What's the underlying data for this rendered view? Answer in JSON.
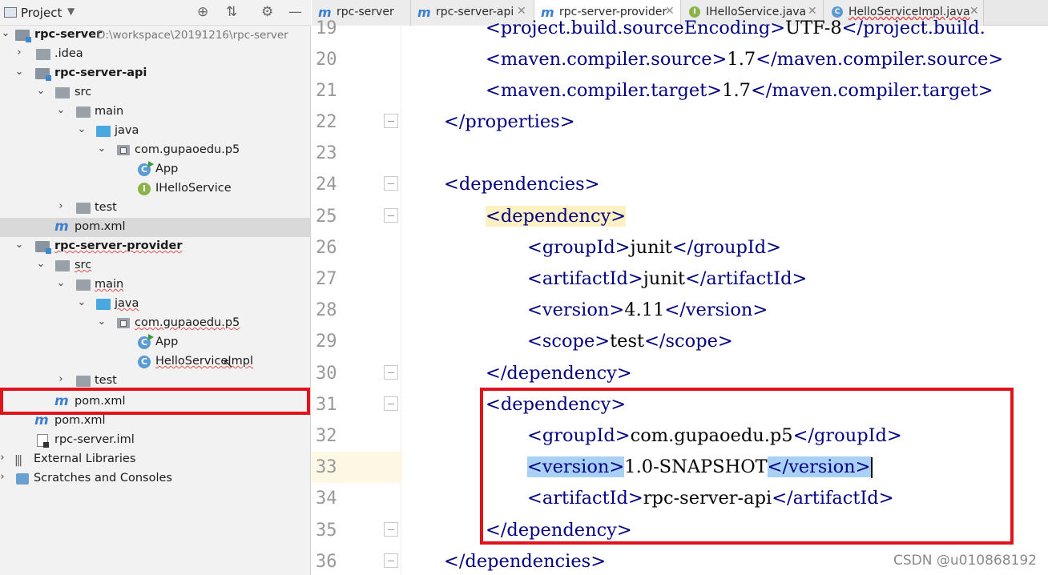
{
  "project_panel": {
    "title": "Project",
    "tree": [
      {
        "label": "rpc-server",
        "path": "D:\\workspace\\20191216\\rpc-server"
      },
      {
        "label": ".idea"
      },
      {
        "label": "rpc-server-api"
      },
      {
        "label": "src"
      },
      {
        "label": "main"
      },
      {
        "label": "java"
      },
      {
        "label": "com.gupaoedu.p5"
      },
      {
        "label": "App"
      },
      {
        "label": "IHelloService"
      },
      {
        "label": "test"
      },
      {
        "label": "pom.xml"
      },
      {
        "label": "rpc-server-provider"
      },
      {
        "label": "src"
      },
      {
        "label": "main"
      },
      {
        "label": "java"
      },
      {
        "label": "com.gupaoedu.p5"
      },
      {
        "label": "App"
      },
      {
        "label": "HelloServiceImpl"
      },
      {
        "label": "test"
      },
      {
        "label": "pom.xml"
      },
      {
        "label": "pom.xml"
      },
      {
        "label": "rpc-server.iml"
      },
      {
        "label": "External Libraries"
      },
      {
        "label": "Scratches and Consoles"
      }
    ]
  },
  "tabs": [
    {
      "label": "rpc-server",
      "icon": "maven-icon"
    },
    {
      "label": "rpc-server-api",
      "icon": "maven-icon"
    },
    {
      "label": "rpc-server-provider",
      "icon": "maven-icon",
      "active": true
    },
    {
      "label": "IHelloService.java",
      "icon": "interface-icon"
    },
    {
      "label": "HelloServiceImpl.java",
      "icon": "class-icon"
    }
  ],
  "editor": {
    "line_numbers": [
      "19",
      "20",
      "21",
      "22",
      "23",
      "24",
      "25",
      "26",
      "27",
      "28",
      "29",
      "30",
      "31",
      "32",
      "33",
      "34",
      "35",
      "36"
    ],
    "lines": [
      {
        "open": "<project.build.sourceEncoding>",
        "text": "UTF-8",
        "close": "</project.build."
      },
      {
        "open": "<maven.compiler.source>",
        "text": "1.7",
        "close": "</maven.compiler.source>"
      },
      {
        "open": "<maven.compiler.target>",
        "text": "1.7",
        "close": "</maven.compiler.target>"
      },
      {
        "open": "</properties>",
        "text": "",
        "close": ""
      },
      {
        "open": "",
        "text": "",
        "close": ""
      },
      {
        "open": "<dependencies>",
        "text": "",
        "close": ""
      },
      {
        "open": "<dependency>",
        "text": "",
        "close": ""
      },
      {
        "open": "<groupId>",
        "text": "junit",
        "close": "</groupId>"
      },
      {
        "open": "<artifactId>",
        "text": "junit",
        "close": "</artifactId>"
      },
      {
        "open": "<version>",
        "text": "4.11",
        "close": "</version>"
      },
      {
        "open": "<scope>",
        "text": "test",
        "close": "</scope>"
      },
      {
        "open": "</dependency>",
        "text": "",
        "close": ""
      },
      {
        "open": "<dependency>",
        "text": "",
        "close": ""
      },
      {
        "open": "<groupId>",
        "text": "com.gupaoedu.p5",
        "close": "</groupId>"
      },
      {
        "open": "<version>",
        "text": "1.0-SNAPSHOT",
        "close": "</version>"
      },
      {
        "open": "<artifactId>",
        "text": "rpc-server-api",
        "close": "</artifactId>"
      },
      {
        "open": "</dependency>",
        "text": "",
        "close": ""
      },
      {
        "open": "</dependencies>",
        "text": "",
        "close": ""
      }
    ]
  },
  "watermark": "CSDN @u010868192",
  "colors": {
    "highlight_box": "#e0141c",
    "tag": "#000080",
    "current_line": "#fcf8e3"
  }
}
